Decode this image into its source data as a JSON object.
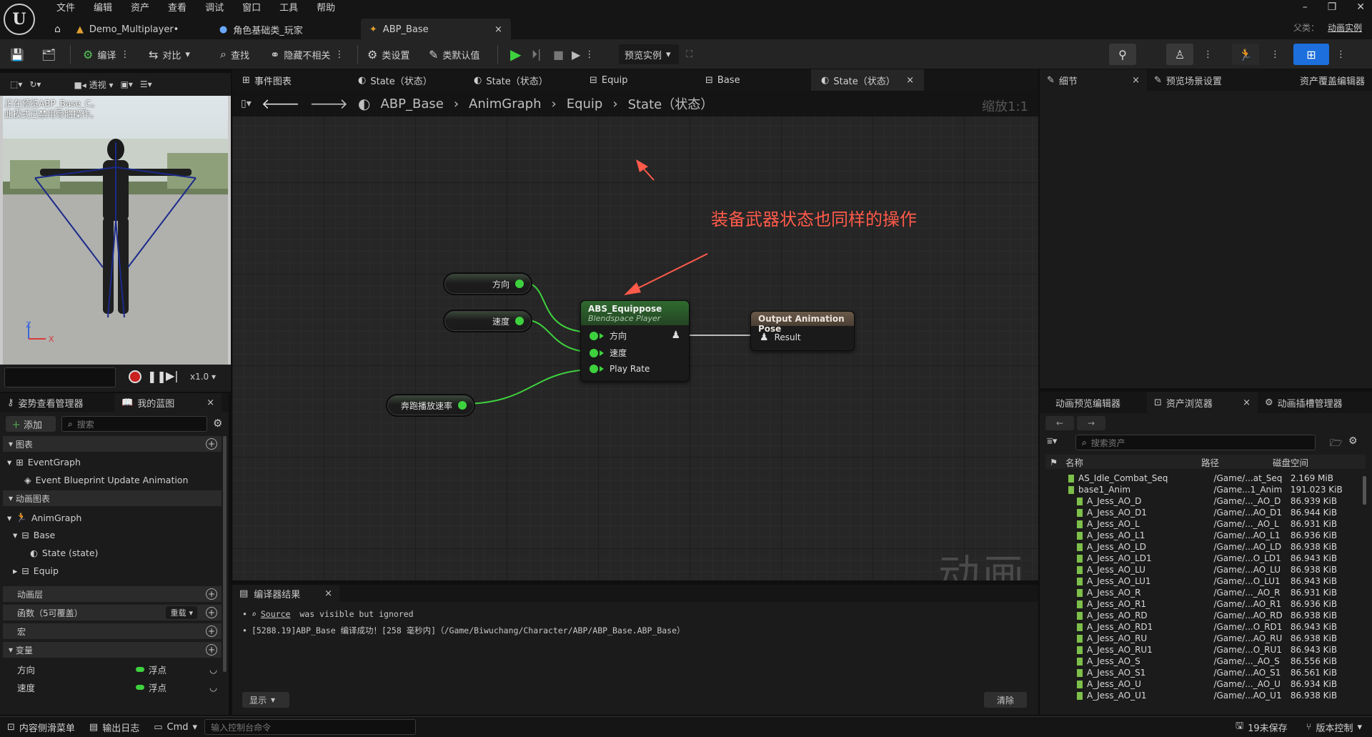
{
  "menu": [
    "文件",
    "编辑",
    "资产",
    "查看",
    "调试",
    "窗口",
    "工具",
    "帮助"
  ],
  "doc_tabs": [
    {
      "label": "Demo_Multiplayer•",
      "icon": "level-icon"
    },
    {
      "label": "角色基础类_玩家",
      "icon": "character-icon"
    },
    {
      "label": "ABP_Base",
      "icon": "anim-blueprint-icon",
      "close": "×"
    }
  ],
  "parent_class": {
    "label": "父类：",
    "value": "动画实例"
  },
  "toolbar": {
    "compile": "编译",
    "diff": "对比",
    "find": "查找",
    "hide_unrelated": "隐藏不相关",
    "class_settings": "类设置",
    "class_defaults": "类默认值",
    "preview_instance": "预览实例"
  },
  "viewport": {
    "perspective": "透视",
    "message_line1": "正在预览ABP_Base_C。",
    "message_line2": "此模式已禁用骨骼操作。",
    "axis_z": "Z",
    "axis_x": "X",
    "speed": "x1.0"
  },
  "left_tabs": {
    "pose_watch": "姿势查看管理器",
    "my_blueprint": "我的蓝图",
    "close": "×"
  },
  "my_blueprint": {
    "add": "添加",
    "search_placeholder": "搜索",
    "graphs": "图表",
    "event_graph": "EventGraph",
    "event_update": "Event Blueprint Update Animation",
    "anim_graphs": "动画图表",
    "anim_graph": "AnimGraph",
    "base": "Base",
    "state": "State (state)",
    "equip": "Equip",
    "anim_layers": "动画层",
    "functions": "函数（5可覆盖）",
    "override": "重载",
    "macros": "宏",
    "variables": "变量",
    "vars": [
      {
        "name": "方向",
        "type": "浮点"
      },
      {
        "name": "速度",
        "type": "浮点"
      }
    ]
  },
  "graph_tabs": [
    {
      "label": "事件图表",
      "icon": "event-graph-icon",
      "active": false
    },
    {
      "label": "State（状态）",
      "icon": "state-icon",
      "active": false
    },
    {
      "label": "State（状态）",
      "icon": "state-icon",
      "active": false
    },
    {
      "label": "Equip",
      "icon": "statemachine-icon",
      "active": false
    },
    {
      "label": "Base",
      "icon": "statemachine-icon",
      "active": false
    },
    {
      "label": "State（状态）",
      "icon": "state-icon",
      "active": true,
      "close": "×"
    }
  ],
  "breadcrumb": [
    "ABP_Base",
    "AnimGraph",
    "Equip",
    "State（状态）"
  ],
  "zoom_label": "缩放1:1",
  "annotation": "装备武器状态也同样的操作",
  "watermark": "动画",
  "nodes": {
    "var_direction": "方向",
    "var_speed": "速度",
    "var_runrate": "奔跑播放速率",
    "blendspace": {
      "title": "ABS_Equippose",
      "subtitle": "Blendspace Player",
      "pins": [
        "方向",
        "速度",
        "Play Rate"
      ]
    },
    "output": {
      "title": "Output Animation Pose",
      "pin": "Result"
    }
  },
  "compiler": {
    "tab": "编译器结果",
    "close": "×",
    "line1_link": "Source",
    "line1_rest": " was visible but ignored",
    "line2": "[5288.19]ABP_Base 编译成功！[258 毫秒内]（/Game/Biwuchang/Character/ABP/ABP_Base.ABP_Base）",
    "show": "显示",
    "clear": "清除"
  },
  "right_tabs": {
    "details": "细节",
    "preview_scene": "预览场景设置",
    "asset_override": "资产覆盖编辑器",
    "close": "×"
  },
  "asset_tabs": {
    "anim_preview": "动画预览编辑器",
    "asset_browser": "资产浏览器",
    "anim_slot": "动画插槽管理器",
    "close": "×"
  },
  "asset_browser": {
    "search_placeholder": "搜索资产",
    "columns": [
      "名称",
      "路径",
      "磁盘空间"
    ],
    "rows": [
      [
        "AS_Idle_Combat_Seq",
        "/Game/...at_Seq",
        "2.169 MiB"
      ],
      [
        "base1_Anim",
        "/Game...1_Anim",
        "191.023 KiB"
      ],
      [
        "A_Jess_AO_D",
        "/Game/..._AO_D",
        "86.939 KiB"
      ],
      [
        "A_Jess_AO_D1",
        "/Game/...AO_D1",
        "86.944 KiB"
      ],
      [
        "A_Jess_AO_L",
        "/Game/..._AO_L",
        "86.931 KiB"
      ],
      [
        "A_Jess_AO_L1",
        "/Game/...AO_L1",
        "86.936 KiB"
      ],
      [
        "A_Jess_AO_LD",
        "/Game/...AO_LD",
        "86.938 KiB"
      ],
      [
        "A_Jess_AO_LD1",
        "/Game/...O_LD1",
        "86.943 KiB"
      ],
      [
        "A_Jess_AO_LU",
        "/Game/...AO_LU",
        "86.938 KiB"
      ],
      [
        "A_Jess_AO_LU1",
        "/Game/...O_LU1",
        "86.943 KiB"
      ],
      [
        "A_Jess_AO_R",
        "/Game/..._AO_R",
        "86.931 KiB"
      ],
      [
        "A_Jess_AO_R1",
        "/Game/...AO_R1",
        "86.936 KiB"
      ],
      [
        "A_Jess_AO_RD",
        "/Game/...AO_RD",
        "86.938 KiB"
      ],
      [
        "A_Jess_AO_RD1",
        "/Game/...O_RD1",
        "86.943 KiB"
      ],
      [
        "A_Jess_AO_RU",
        "/Game/...AO_RU",
        "86.938 KiB"
      ],
      [
        "A_Jess_AO_RU1",
        "/Game/...O_RU1",
        "86.943 KiB"
      ],
      [
        "A_Jess_AO_S",
        "/Game/..._AO_S",
        "86.556 KiB"
      ],
      [
        "A_Jess_AO_S1",
        "/Game/...AO_S1",
        "86.561 KiB"
      ],
      [
        "A_Jess_AO_U",
        "/Game/..._AO_U",
        "86.934 KiB"
      ],
      [
        "A_Jess_AO_U1",
        "/Game/...AO_U1",
        "86.938 KiB"
      ]
    ]
  },
  "status": {
    "content_drawer": "内容侧滑菜单",
    "output_log": "输出日志",
    "cmd": "Cmd",
    "console_placeholder": "输入控制台命令",
    "unsaved": "19未保存",
    "source_control": "版本控制"
  },
  "colors": {
    "pin_green": "#3ed13e",
    "annotation_red": "#ff5a4a",
    "active_blue": "#1c6fdc"
  }
}
